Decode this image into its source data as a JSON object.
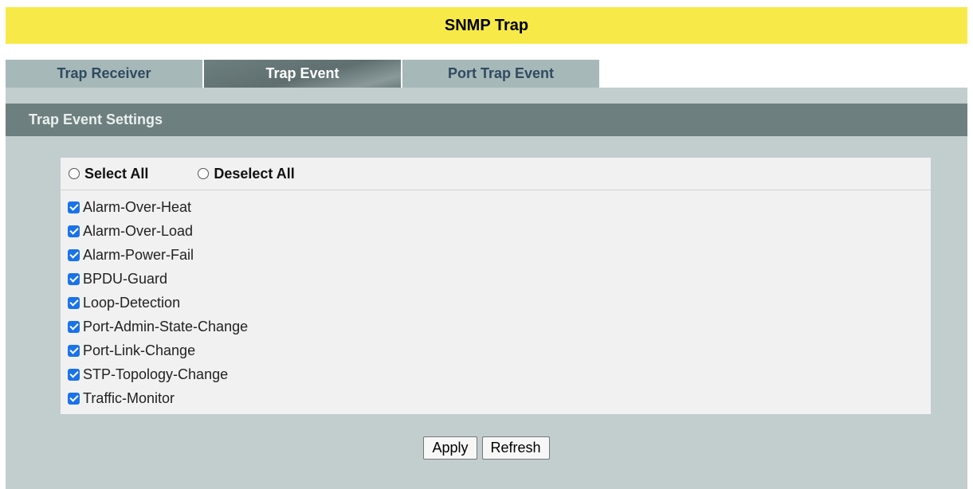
{
  "page": {
    "title": "SNMP Trap"
  },
  "tabs": [
    {
      "label": "Trap Receiver",
      "active": false
    },
    {
      "label": "Trap Event",
      "active": true
    },
    {
      "label": "Port Trap Event",
      "active": false
    }
  ],
  "section": {
    "title": "Trap Event Settings"
  },
  "selection": {
    "select_all": "Select All",
    "deselect_all": "Deselect All"
  },
  "events": [
    {
      "label": "Alarm-Over-Heat",
      "checked": true
    },
    {
      "label": "Alarm-Over-Load",
      "checked": true
    },
    {
      "label": "Alarm-Power-Fail",
      "checked": true
    },
    {
      "label": "BPDU-Guard",
      "checked": true
    },
    {
      "label": "Loop-Detection",
      "checked": true
    },
    {
      "label": "Port-Admin-State-Change",
      "checked": true
    },
    {
      "label": "Port-Link-Change",
      "checked": true
    },
    {
      "label": "STP-Topology-Change",
      "checked": true
    },
    {
      "label": "Traffic-Monitor",
      "checked": true
    }
  ],
  "buttons": {
    "apply": "Apply",
    "refresh": "Refresh"
  },
  "colors": {
    "title_bar": "#f7ea48",
    "tab_inactive": "#a7b8b9",
    "tab_active": "#6e7f7f",
    "section_header": "#6e7f7f",
    "content_bg": "#c2cdce",
    "checkbox": "#1a73e8"
  }
}
